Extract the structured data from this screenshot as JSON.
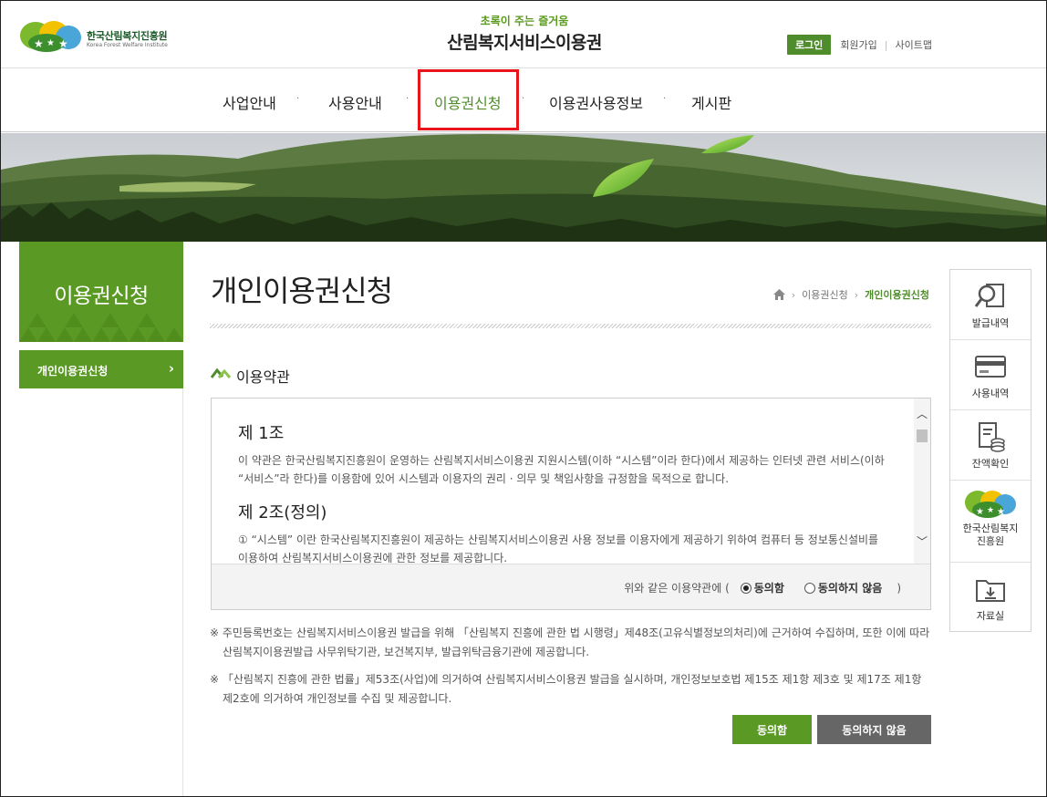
{
  "header": {
    "logo_text": "한국산림복지진흥원",
    "logo_sub": "Korea Forest Welfare Institute",
    "slogan": "초록이 주는 즐거움",
    "site_title": "산림복지서비스이용권",
    "login": "로그인",
    "join": "회원가입",
    "sitemap": "사이트맵"
  },
  "gnb": {
    "items": [
      "사업안내",
      "사용안내",
      "이용권신청",
      "이용권사용정보",
      "게시판"
    ],
    "active_index": 2
  },
  "lnb": {
    "title": "이용권신청",
    "items": [
      "개인이용권신청"
    ]
  },
  "content": {
    "page_title": "개인이용권신청",
    "breadcrumb": [
      "이용권신청",
      "개인이용권신청"
    ],
    "section_title": "이용약관",
    "terms": {
      "art1_title": "제 1조",
      "art1_body": "이 약관은 한국산림복지진흥원이 운영하는 산림복지서비스이용권 지원시스템(이하 “시스템”이라 한다)에서 제공하는 인터넷 관련 서비스(이하 “서비스”라 한다)를 이용함에 있어 시스템과 이용자의 권리 · 의무 및 책임사항을 규정함을 목적으로 합니다.",
      "art2_title": "제 2조(정의)",
      "art2_body": "① “시스템” 이란 한국산림복지진흥원이 제공하는 산림복지서비스이용권 사용 정보를 이용자에게 제공하기 위하여 컴퓨터 등 정보통신설비를 이용하여 산림복지서비스이용권에 관한 정보를 제공합니다."
    },
    "agree_question": "위와 같은 이용약관에 (",
    "agree_option": "동의함",
    "disagree_option": "동의하지 않음",
    "agree_close": ")",
    "agree_selected": "agree",
    "note1": "※ 주민등록번호는 산림복지서비스이용권 발급을 위해 「산림복지 진흥에 관한 법 시행령」제48조(고유식별정보의처리)에 근거하여 수집하며, 또한 이에 따라 산림복지이용권발급 사무위탁기관, 보건복지부, 발급위탁금융기관에 제공합니다.",
    "note2": "※ 「산림복지 진흥에 관한 법률」제53조(사업)에 의거하여 산림복지서비스이용권 발급을 실시하며, 개인정보보호법 제15조 제1항 제3호 및 제17조 제1항 제2호에 의거하여 개인정보를 수집 및 제공합니다.",
    "btn_agree": "동의함",
    "btn_disagree": "동의하지 않음"
  },
  "quick_menu": {
    "items": [
      "발급내역",
      "사용내역",
      "잔액확인",
      "한국산림복지 진흥원",
      "자료실"
    ]
  },
  "colors": {
    "brand_green": "#5a9a24",
    "highlight_red": "#e8161c"
  }
}
